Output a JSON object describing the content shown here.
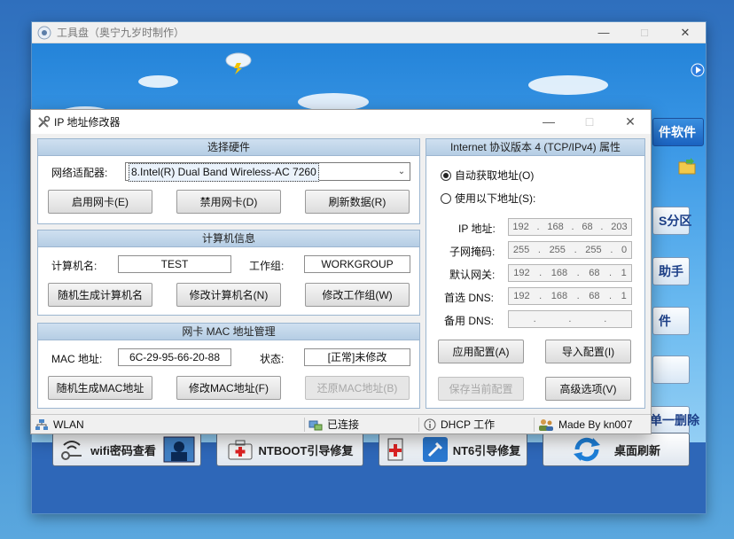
{
  "app": {
    "title": "工具盘（奥宁九岁时制作）",
    "side_buttons": [
      "件软件",
      "S分区",
      "助手",
      "件",
      "",
      "单一删除"
    ],
    "bottom_buttons": {
      "wifi": "wifi密码查看",
      "ntboot": "NTBOOT引导修复",
      "nt6": "NT6引导修复",
      "refresh": "桌面刷新"
    }
  },
  "dialog": {
    "title": "IP 地址修改器",
    "hardware": {
      "header": "选择硬件",
      "adapter_label": "网络适配器:",
      "adapter_value": "8.Intel(R) Dual Band Wireless-AC 7260",
      "enable_btn": "启用网卡(E)",
      "disable_btn": "禁用网卡(D)",
      "refresh_btn": "刷新数据(R)"
    },
    "computer": {
      "header": "计算机信息",
      "name_label": "计算机名:",
      "name_value": "TEST",
      "group_label": "工作组:",
      "group_value": "WORKGROUP",
      "random_name_btn": "随机生成计算机名",
      "rename_btn": "修改计算机名(N)",
      "regroup_btn": "修改工作组(W)"
    },
    "mac": {
      "header": "网卡 MAC 地址管理",
      "mac_label": "MAC 地址:",
      "mac_value": "6C-29-95-66-20-88",
      "state_label": "状态:",
      "state_value": "[正常]未修改",
      "random_btn": "随机生成MAC地址",
      "modify_btn": "修改MAC地址(F)",
      "restore_btn": "还原MAC地址(B)"
    },
    "ipv4": {
      "header": "Internet 协议版本 4 (TCP/IPv4) 属性",
      "auto_label": "自动获取地址(O)",
      "manual_label": "使用以下地址(S):",
      "ip_label": "IP 地址:",
      "mask_label": "子网掩码:",
      "gateway_label": "默认网关:",
      "dns1_label": "首选 DNS:",
      "dns2_label": "备用 DNS:",
      "ip": [
        "192",
        "168",
        "68",
        "203"
      ],
      "mask": [
        "255",
        "255",
        "255",
        "0"
      ],
      "gateway": [
        "192",
        "168",
        "68",
        "1"
      ],
      "dns1": [
        "192",
        "168",
        "68",
        "1"
      ],
      "dns2": [
        "",
        "",
        "",
        ""
      ],
      "apply_btn": "应用配置(A)",
      "import_btn": "导入配置(I)",
      "save_btn": "保存当前配置",
      "advanced_btn": "高级选项(V)"
    },
    "status": {
      "wlan": "WLAN",
      "connected": "已连接",
      "dhcp": "DHCP 工作",
      "author": "Made By kn007"
    }
  }
}
